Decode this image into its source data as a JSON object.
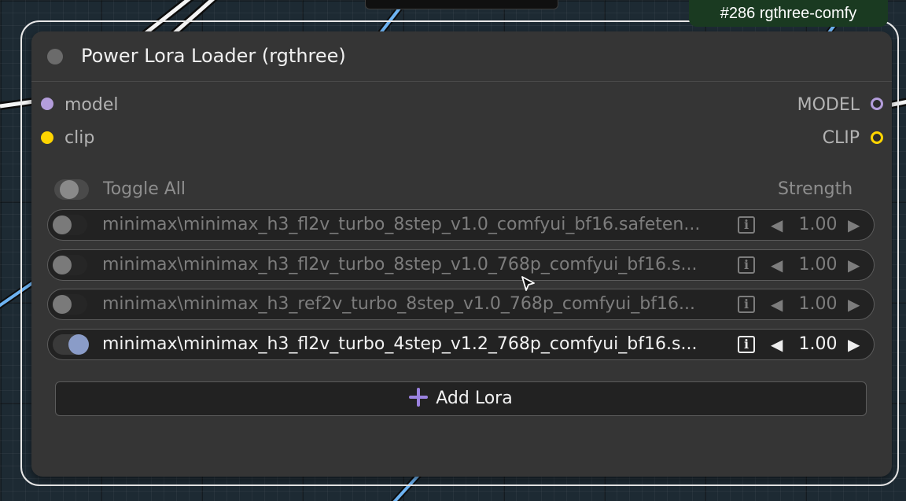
{
  "node": {
    "badge": "#286 rgthree-comfy",
    "title": "Power Lora Loader (rgthree)",
    "inputs": [
      {
        "label": "model",
        "color": "#b39ddb"
      },
      {
        "label": "clip",
        "color": "#ffd500"
      }
    ],
    "outputs": [
      {
        "label": "MODEL",
        "color": "#b39ddb"
      },
      {
        "label": "CLIP",
        "color": "#ffd500"
      }
    ],
    "toggle_all_label": "Toggle All",
    "strength_header": "Strength",
    "loras": [
      {
        "name": "minimax\\minimax_h3_fl2v_turbo_8step_v1.0_comfyui_bf16.safeten...",
        "strength": "1.00",
        "enabled": false
      },
      {
        "name": "minimax\\minimax_h3_fl2v_turbo_8step_v1.0_768p_comfyui_bf16.s...",
        "strength": "1.00",
        "enabled": false
      },
      {
        "name": "minimax\\minimax_h3_ref2v_turbo_8step_v1.0_768p_comfyui_bf16...",
        "strength": "1.00",
        "enabled": false
      },
      {
        "name": "minimax\\minimax_h3_fl2v_turbo_4step_v1.2_768p_comfyui_bf16.s...",
        "strength": "1.00",
        "enabled": true
      }
    ],
    "add_lora_label": "Add Lora",
    "info_glyph": "i",
    "decrement_glyph": "◀",
    "increment_glyph": "▶"
  },
  "icons": {
    "add": "plus-icon",
    "info": "info-icon",
    "cursor": "mouse-cursor-icon"
  },
  "colors": {
    "canvas_bg": "#1d2a33",
    "node_bg": "#353535",
    "badge_bg": "#1a3a21",
    "wire_blue": "#6db3f2",
    "toggle_on_knob": "#8a9cc8",
    "accent_plus": "#9b82e0"
  }
}
